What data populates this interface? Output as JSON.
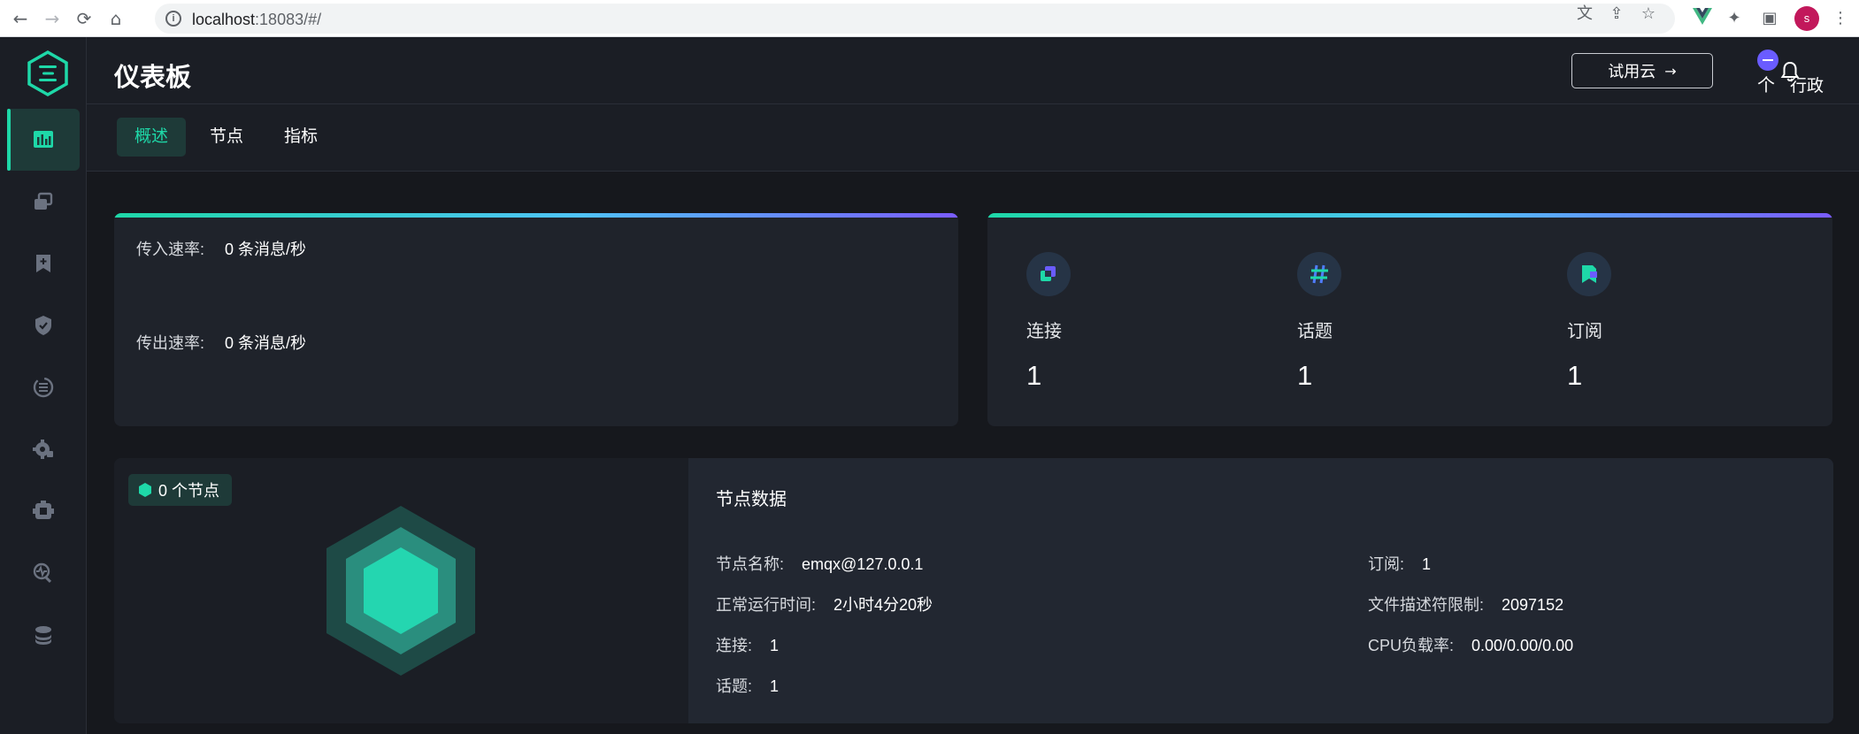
{
  "browser": {
    "url_host": "localhost",
    "url_rest": ":18083/#/",
    "profile_initial": "s"
  },
  "header": {
    "title": "仪表板",
    "cloud_button": "试用云",
    "user_glyph": "个",
    "user_name": "行政"
  },
  "tabs": [
    {
      "label": "概述",
      "active": true
    },
    {
      "label": "节点",
      "active": false
    },
    {
      "label": "指标",
      "active": false
    }
  ],
  "rates": {
    "in_label": "传入速率:",
    "in_value": "0 条消息/秒",
    "out_label": "传出速率:",
    "out_value": "0 条消息/秒"
  },
  "stats": [
    {
      "label": "连接",
      "value": "1",
      "icon": "connections-icon"
    },
    {
      "label": "话题",
      "value": "1",
      "icon": "topics-icon"
    },
    {
      "label": "订阅",
      "value": "1",
      "icon": "subscriptions-icon"
    }
  ],
  "nodes": {
    "badge": "0 个节点",
    "title": "节点数据",
    "name_label": "节点名称:",
    "name_value": "emqx@127.0.0.1",
    "uptime_label": "正常运行时间:",
    "uptime_value": "2小时4分20秒",
    "conn_label": "连接:",
    "conn_value": "1",
    "topics_label": "话题:",
    "topics_value": "1",
    "subs_label": "订阅:",
    "subs_value": "1",
    "fd_label": "文件描述符限制:",
    "fd_value": "2097152",
    "cpu_label": "CPU负载率:",
    "cpu_value": "0.00/0.00/0.00"
  },
  "colors": {
    "accent": "#1ed8a8",
    "background": "#16181d",
    "card": "#1f232b"
  }
}
